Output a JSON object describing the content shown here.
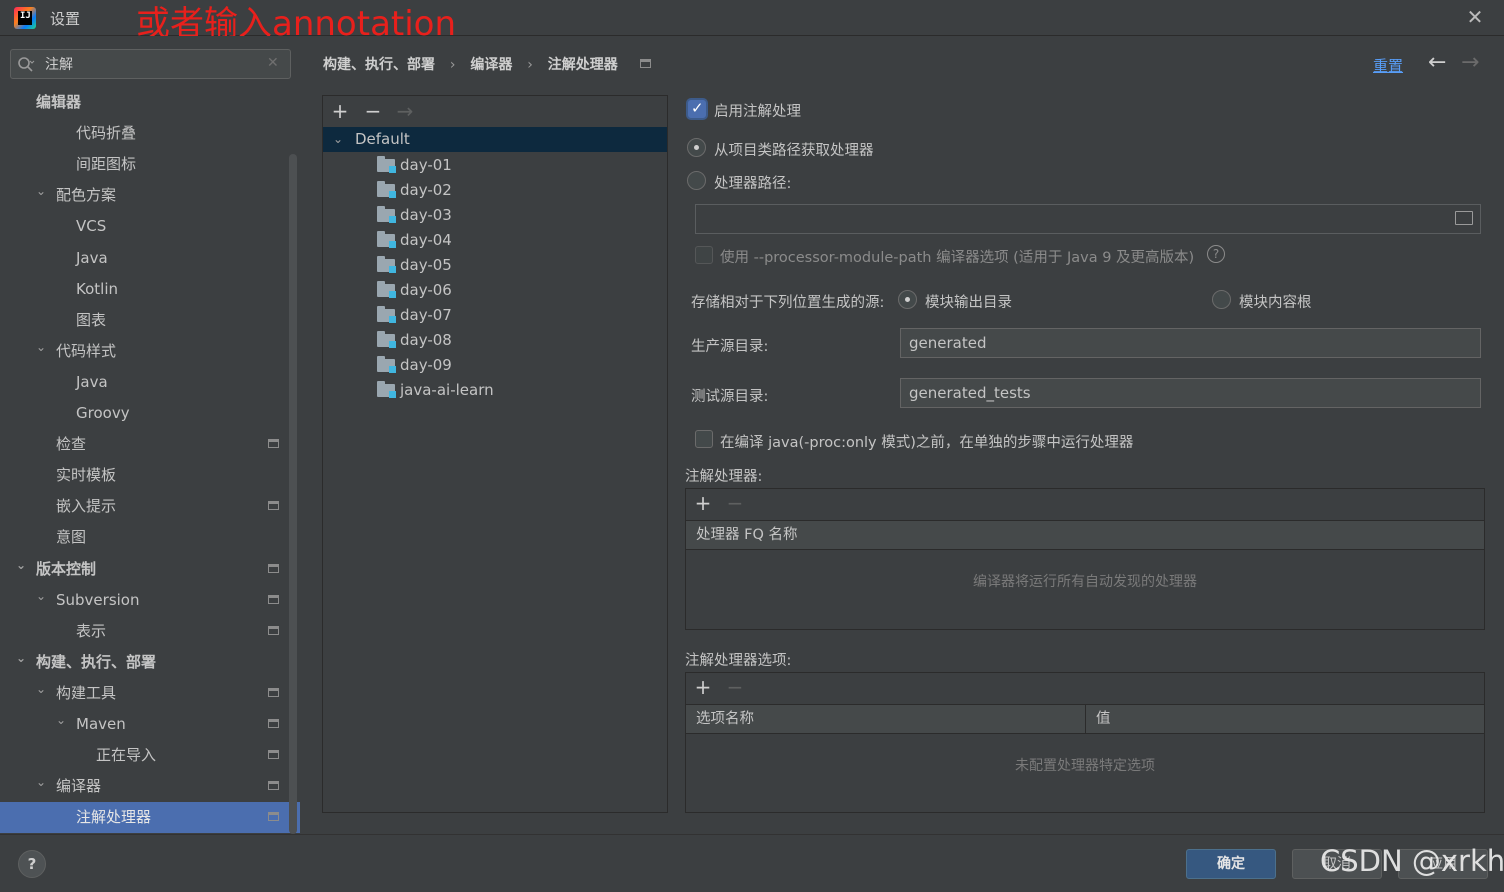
{
  "window": {
    "title": "设置",
    "annotation": "或者输入annotation",
    "close": "✕"
  },
  "search": {
    "value": "注解",
    "placeholder": ""
  },
  "sidebar": {
    "items": [
      {
        "label": "编辑器",
        "bold": true,
        "chev": "",
        "indent": 0
      },
      {
        "label": "代码折叠",
        "chev": "",
        "indent": 2
      },
      {
        "label": "间距图标",
        "chev": "",
        "indent": 2
      },
      {
        "label": "配色方案",
        "chev": "⌄",
        "indent": 1
      },
      {
        "label": "VCS",
        "chev": "",
        "indent": 2
      },
      {
        "label": "Java",
        "chev": "",
        "indent": 2
      },
      {
        "label": "Kotlin",
        "chev": "",
        "indent": 2
      },
      {
        "label": "图表",
        "chev": "",
        "indent": 2
      },
      {
        "label": "代码样式",
        "chev": "⌄",
        "indent": 1
      },
      {
        "label": "Java",
        "chev": "",
        "indent": 2
      },
      {
        "label": "Groovy",
        "chev": "",
        "indent": 2
      },
      {
        "label": "检查",
        "chev": "",
        "indent": 1,
        "proj": true
      },
      {
        "label": "实时模板",
        "chev": "",
        "indent": 1
      },
      {
        "label": "嵌入提示",
        "chev": "",
        "indent": 1,
        "proj": true
      },
      {
        "label": "意图",
        "chev": "",
        "indent": 1
      },
      {
        "label": "版本控制",
        "bold": true,
        "chev": "⌄",
        "indent": 0,
        "proj": true
      },
      {
        "label": "Subversion",
        "chev": "⌄",
        "indent": 1,
        "proj": true
      },
      {
        "label": "表示",
        "chev": "",
        "indent": 2,
        "proj": true
      },
      {
        "label": "构建、执行、部署",
        "bold": true,
        "chev": "⌄",
        "indent": 0
      },
      {
        "label": "构建工具",
        "chev": "⌄",
        "indent": 1,
        "proj": true
      },
      {
        "label": "Maven",
        "chev": "⌄",
        "indent": 2,
        "proj": true
      },
      {
        "label": "正在导入",
        "chev": "",
        "indent": 3,
        "proj": true
      },
      {
        "label": "编译器",
        "chev": "⌄",
        "indent": 1,
        "proj": true
      },
      {
        "label": "注解处理器",
        "chev": "",
        "indent": 2,
        "proj": true,
        "selected": true
      }
    ]
  },
  "breadcrumb": {
    "part1": "构建、执行、部署",
    "part2": "编译器",
    "part3": "注解处理器",
    "sep": "›"
  },
  "header": {
    "reset": "重置",
    "back": "←",
    "forward": "→"
  },
  "module_tree": {
    "add": "+",
    "remove": "−",
    "move": "→",
    "root": "Default",
    "modules": [
      "day-01",
      "day-02",
      "day-03",
      "day-04",
      "day-05",
      "day-06",
      "day-07",
      "day-08",
      "day-09",
      "java-ai-learn"
    ]
  },
  "form": {
    "enable_processing": "启用注解处理",
    "from_classpath": "从项目类路径获取处理器",
    "processor_path": "处理器路径:",
    "processor_path_value": "",
    "module_path_option": "使用 --processor-module-path 编译器选项 (适用于 Java 9 及更高版本)",
    "help_glyph": "?",
    "store_label": "存储相对于下列位置生成的源:",
    "module_output": "模块输出目录",
    "module_content_root": "模块内容根",
    "prod_label": "生产源目录:",
    "prod_value": "generated",
    "test_label": "测试源目录:",
    "test_value": "generated_tests",
    "proc_only": "在编译 java(-proc:only 模式)之前，在单独的步骤中运行处理器"
  },
  "processors_table": {
    "title": "注解处理器:",
    "add": "+",
    "remove": "−",
    "column": "处理器 FQ 名称",
    "empty": "编译器将运行所有自动发现的处理器"
  },
  "options_table": {
    "title": "注解处理器选项:",
    "add": "+",
    "remove": "−",
    "col_name": "选项名称",
    "col_value": "值",
    "empty": "未配置处理器特定选项"
  },
  "footer": {
    "help": "?",
    "ok": "确定",
    "cancel": "取消",
    "apply": "应用",
    "watermark": "CSDN @xrkhy"
  }
}
